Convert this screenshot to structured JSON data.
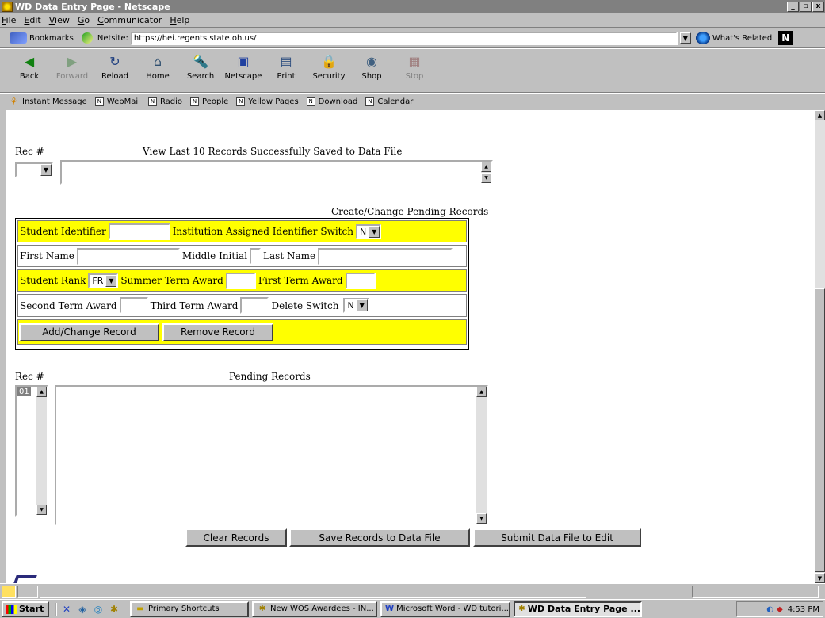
{
  "window": {
    "title": "WD Data Entry Page - Netscape",
    "minimize": "_",
    "maximize": "▫",
    "close": "x"
  },
  "menu": [
    "File",
    "Edit",
    "View",
    "Go",
    "Communicator",
    "Help"
  ],
  "location": {
    "bookmarks_label": "Bookmarks",
    "netsite_label": "Netsite:",
    "url": "https://hei.regents.state.oh.us/",
    "related_label": "What's Related",
    "logo": "N"
  },
  "nav": [
    {
      "label": "Back",
      "icon": "back-arrow-icon",
      "glyph": "◀"
    },
    {
      "label": "Forward",
      "icon": "forward-arrow-icon",
      "glyph": "▶",
      "disabled": true
    },
    {
      "label": "Reload",
      "icon": "reload-icon",
      "glyph": "↻"
    },
    {
      "label": "Home",
      "icon": "home-icon",
      "glyph": "⌂"
    },
    {
      "label": "Search",
      "icon": "search-icon",
      "glyph": "🔦"
    },
    {
      "label": "Netscape",
      "icon": "netscape-icon",
      "glyph": "▣"
    },
    {
      "label": "Print",
      "icon": "print-icon",
      "glyph": "▤"
    },
    {
      "label": "Security",
      "icon": "lock-icon",
      "glyph": "🔒"
    },
    {
      "label": "Shop",
      "icon": "shop-icon",
      "glyph": "◉"
    },
    {
      "label": "Stop",
      "icon": "stop-icon",
      "glyph": "▦",
      "disabled": true
    }
  ],
  "personal": [
    "Instant Message",
    "WebMail",
    "Radio",
    "People",
    "Yellow Pages",
    "Download",
    "Calendar"
  ],
  "page": {
    "rec_label": "Rec #",
    "view_last_title": "View Last 10 Records Successfully Saved to Data File",
    "create_title": "Create/Change Pending Records",
    "form": {
      "student_identifier": "Student Identifier",
      "inst_switch_label": "Institution Assigned Identifier Switch",
      "inst_switch_value": "N",
      "first_name": "First Name",
      "middle_initial": "Middle Initial",
      "last_name": "Last Name",
      "student_rank": "Student Rank",
      "student_rank_value": "FR",
      "summer_award": "Summer Term Award",
      "first_award": "First Term Award",
      "second_award": "Second Term Award",
      "third_award": "Third Term Award",
      "delete_switch": "Delete Switch",
      "delete_switch_value": "N",
      "add_button": "Add/Change Record",
      "remove_button": "Remove Record"
    },
    "rec_label2": "Rec #",
    "pending_title": "Pending Records",
    "pending_rec_value": "01",
    "clear_button": "Clear Records",
    "save_button": "Save Records to Data File",
    "submit_button": "Submit Data File to Edit"
  },
  "taskbar": {
    "start": "Start",
    "tasks": [
      {
        "label": "Primary Shortcuts",
        "icon": "folder-icon"
      },
      {
        "label": "New WOS Awardees - IN...",
        "icon": "netscape-icon"
      },
      {
        "label": "Microsoft Word - WD tutori...",
        "icon": "word-icon"
      },
      {
        "label": "WD Data Entry Page ...",
        "icon": "netscape-icon",
        "active": true
      }
    ],
    "clock": "4:53 PM"
  }
}
